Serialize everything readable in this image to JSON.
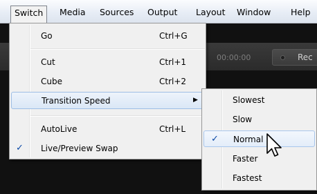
{
  "menubar": {
    "items": [
      "Switch",
      "Media",
      "Sources",
      "Output",
      "Layout",
      "Window",
      "Help"
    ],
    "active": "Switch"
  },
  "app": {
    "timecode": "00:00:00",
    "record_label": "Rec"
  },
  "switch_menu": {
    "items": [
      {
        "label": "Go",
        "shortcut": "Ctrl+G"
      },
      {
        "label": "Cut",
        "shortcut": "Ctrl+1"
      },
      {
        "label": "Cube",
        "shortcut": "Ctrl+2"
      },
      {
        "label": "Transition Speed",
        "shortcut": ""
      },
      {
        "label": "AutoLive",
        "shortcut": "Ctrl+L"
      },
      {
        "label": "Live/Preview Swap",
        "shortcut": ""
      }
    ],
    "highlighted": "Transition Speed",
    "checked": [
      "Live/Preview Swap"
    ]
  },
  "transition_speed_submenu": {
    "items": [
      "Slowest",
      "Slow",
      "Normal",
      "Faster",
      "Fastest"
    ],
    "checked": "Normal",
    "highlighted": "Normal"
  },
  "colors": {
    "menu_bg": "#f0f0f0",
    "highlight_border": "#9ebee5",
    "check": "#0b49a6"
  }
}
